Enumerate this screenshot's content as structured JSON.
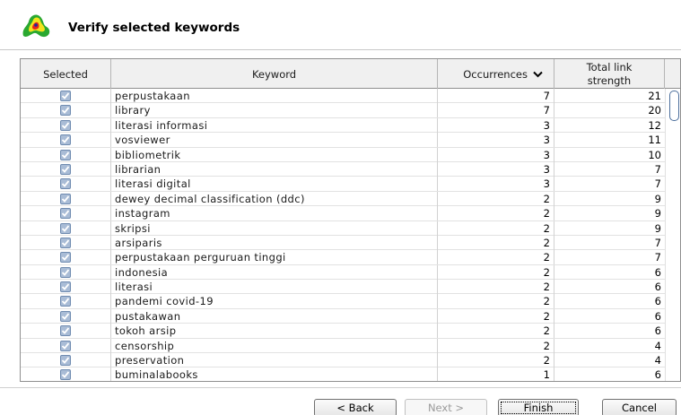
{
  "header": {
    "title": "Verify selected keywords",
    "logo_icon": "vosviewer-logo-icon"
  },
  "table": {
    "columns": {
      "selected": "Selected",
      "keyword": "Keyword",
      "occurrences": "Occurrences",
      "tls_line1": "Total link",
      "tls_line2": "strength"
    },
    "sort_icon": "chevron-down-icon",
    "rows": [
      {
        "keyword": "perpustakaan",
        "occurrences": "7",
        "tls": "21",
        "selected": true
      },
      {
        "keyword": "library",
        "occurrences": "7",
        "tls": "20",
        "selected": true
      },
      {
        "keyword": "literasi informasi",
        "occurrences": "3",
        "tls": "12",
        "selected": true
      },
      {
        "keyword": "vosviewer",
        "occurrences": "3",
        "tls": "11",
        "selected": true
      },
      {
        "keyword": "bibliometrik",
        "occurrences": "3",
        "tls": "10",
        "selected": true
      },
      {
        "keyword": "librarian",
        "occurrences": "3",
        "tls": "7",
        "selected": true
      },
      {
        "keyword": "literasi digital",
        "occurrences": "3",
        "tls": "7",
        "selected": true
      },
      {
        "keyword": "dewey decimal classification (ddc)",
        "occurrences": "2",
        "tls": "9",
        "selected": true
      },
      {
        "keyword": "instagram",
        "occurrences": "2",
        "tls": "9",
        "selected": true
      },
      {
        "keyword": "skripsi",
        "occurrences": "2",
        "tls": "9",
        "selected": true
      },
      {
        "keyword": "arsiparis",
        "occurrences": "2",
        "tls": "7",
        "selected": true
      },
      {
        "keyword": "perpustakaan perguruan tinggi",
        "occurrences": "2",
        "tls": "7",
        "selected": true
      },
      {
        "keyword": "indonesia",
        "occurrences": "2",
        "tls": "6",
        "selected": true
      },
      {
        "keyword": "literasi",
        "occurrences": "2",
        "tls": "6",
        "selected": true
      },
      {
        "keyword": "pandemi covid-19",
        "occurrences": "2",
        "tls": "6",
        "selected": true
      },
      {
        "keyword": "pustakawan",
        "occurrences": "2",
        "tls": "6",
        "selected": true
      },
      {
        "keyword": "tokoh arsip",
        "occurrences": "2",
        "tls": "6",
        "selected": true
      },
      {
        "keyword": "censorship",
        "occurrences": "2",
        "tls": "4",
        "selected": true
      },
      {
        "keyword": "preservation",
        "occurrences": "2",
        "tls": "4",
        "selected": true
      },
      {
        "keyword": "buminalabooks",
        "occurrences": "1",
        "tls": "6",
        "selected": true
      }
    ]
  },
  "footer": {
    "back_label": "< Back",
    "next_label": "Next >",
    "finish_label": "Finish",
    "cancel_label": "Cancel"
  },
  "colors": {
    "checkbox_fill": "#a9bcd6",
    "checkbox_border": "#6f8bb0",
    "scroll_thumb": "#4d6f9c"
  }
}
